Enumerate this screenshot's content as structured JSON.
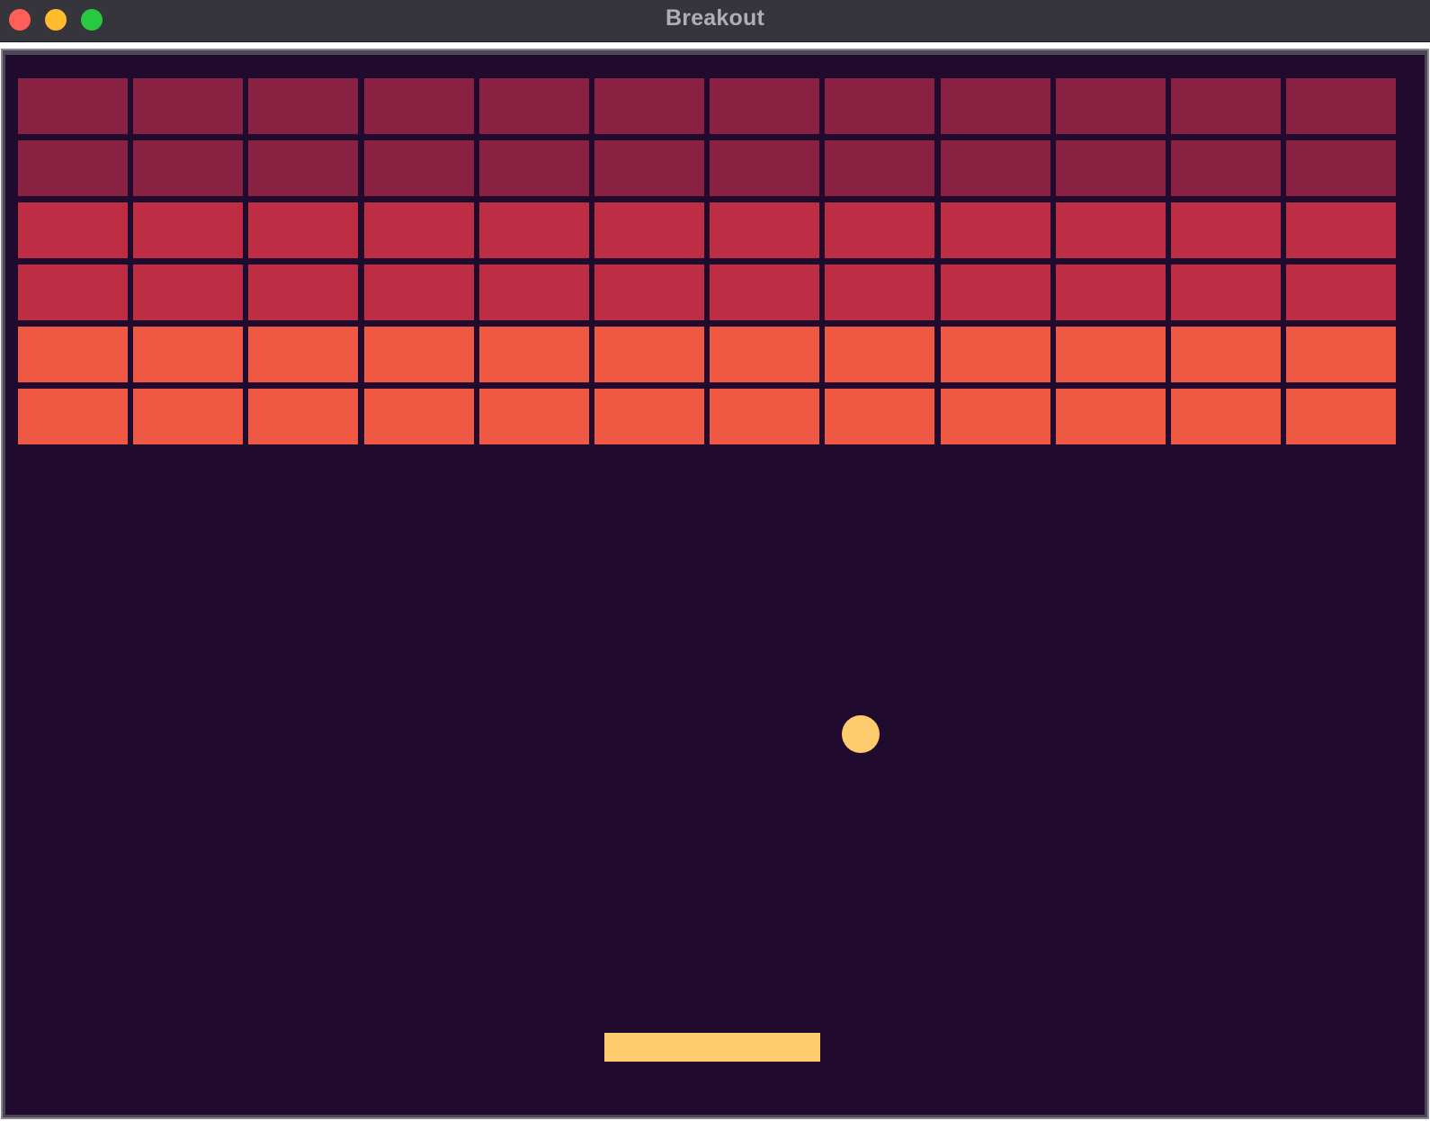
{
  "window": {
    "title": "Breakout"
  },
  "controls": {
    "close_color": "#fe5f57",
    "minimize_color": "#febc2e",
    "zoom_color": "#28c840"
  },
  "game": {
    "background_color": "#200a2e",
    "bricks": {
      "rows": 6,
      "columns": 12,
      "row_colors": [
        "#882142",
        "#882142",
        "#bd2e44",
        "#bd2e44",
        "#ef5842",
        "#ef5842"
      ]
    },
    "ball": {
      "color": "#ffcb6d"
    },
    "paddle": {
      "color": "#ffcb6d"
    }
  }
}
